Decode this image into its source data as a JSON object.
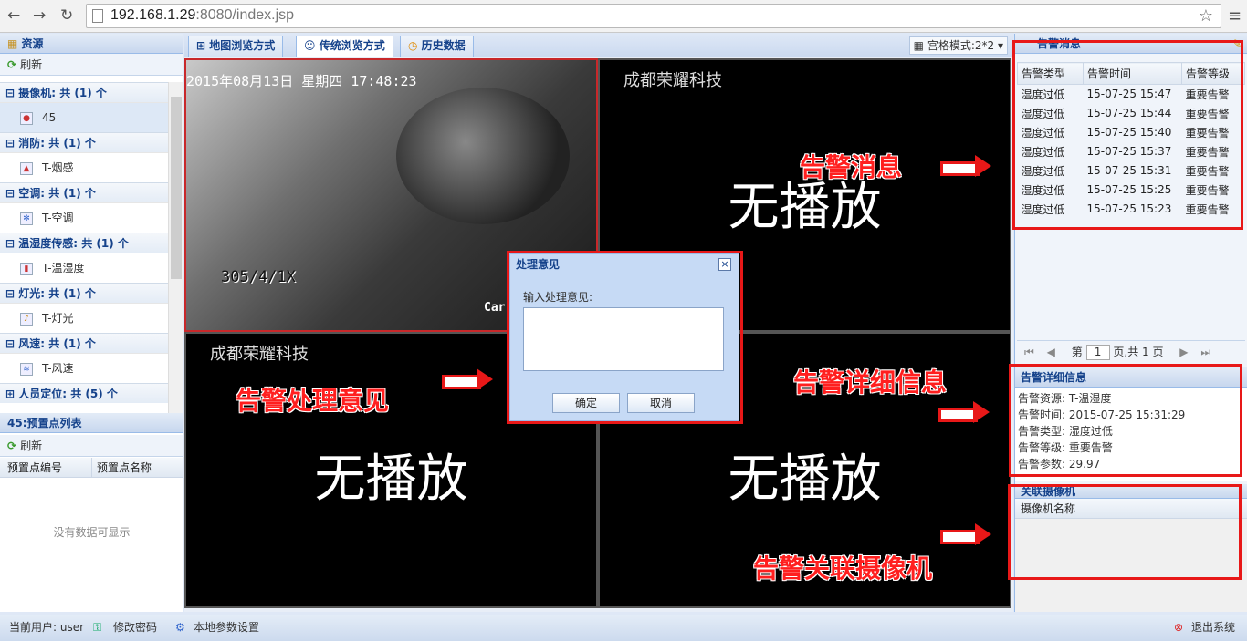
{
  "browser": {
    "url_host": "192.168.1.29",
    "url_rest": ":8080/index.jsp"
  },
  "left": {
    "resources_title": "资源",
    "refresh": "刷新",
    "groups": [
      {
        "name": "摄像机: 共 (1) 个",
        "item": "45",
        "icon": "camera-icon"
      },
      {
        "name": "消防: 共 (1) 个",
        "item": "T-烟感",
        "icon": "fire-icon"
      },
      {
        "name": "空调: 共 (1) 个",
        "item": "T-空调",
        "icon": "snowflake-icon"
      },
      {
        "name": "温湿度传感: 共 (1) 个",
        "item": "T-温湿度",
        "icon": "thermometer-icon"
      },
      {
        "name": "灯光: 共 (1) 个",
        "item": "T-灯光",
        "icon": "bell-icon"
      },
      {
        "name": "风速: 共 (1) 个",
        "item": "T-风速",
        "icon": "wind-icon"
      },
      {
        "name": "人员定位: 共 (5) 个",
        "item": "",
        "icon": ""
      }
    ],
    "preset_title": "45:预置点列表",
    "preset_refresh": "刷新",
    "preset_col1": "预置点编号",
    "preset_col2": "预置点名称",
    "empty": "没有数据可显示"
  },
  "tabs": {
    "map": "地图浏览方式",
    "traditional": "传统浏览方式",
    "history": "历史数据",
    "grid_mode": "宫格模式:2*2"
  },
  "video": {
    "osd_datetime": "2015年08月13日  星期四  17:48:23",
    "osd_ptz": "305/4/1X",
    "osd_cam": "Car",
    "company": "成都荣耀科技",
    "no_play": "无播放"
  },
  "dialog": {
    "title": "处理意见",
    "label": "输入处理意见:",
    "confirm": "确定",
    "cancel": "取消",
    "close": "×"
  },
  "alarms": {
    "title": "告警消息",
    "col_type": "告警类型",
    "col_time": "告警时间",
    "col_level": "告警等级",
    "rows": [
      {
        "type": "湿度过低",
        "time": "15-07-25 15:47",
        "level": "重要告警"
      },
      {
        "type": "湿度过低",
        "time": "15-07-25 15:44",
        "level": "重要告警"
      },
      {
        "type": "湿度过低",
        "time": "15-07-25 15:40",
        "level": "重要告警"
      },
      {
        "type": "湿度过低",
        "time": "15-07-25 15:37",
        "level": "重要告警"
      },
      {
        "type": "湿度过低",
        "time": "15-07-25 15:31",
        "level": "重要告警"
      },
      {
        "type": "湿度过低",
        "time": "15-07-25 15:25",
        "level": "重要告警"
      },
      {
        "type": "湿度过低",
        "time": "15-07-25 15:23",
        "level": "重要告警"
      }
    ],
    "pager_page": "第",
    "pager_value": "1",
    "pager_total": "页,共 1 页"
  },
  "detail": {
    "title": "告警详细信息",
    "source": "告警资源: T-温湿度",
    "time": "告警时间: 2015-07-25 15:31:29",
    "type": "告警类型: 湿度过低",
    "level": "告警等级: 重要告警",
    "param": "告警参数: 29.97"
  },
  "camera_panel": {
    "title": "关联摄像机",
    "col": "摄像机名称"
  },
  "status": {
    "user": "当前用户: user",
    "change_pwd": "修改密码",
    "local_settings": "本地参数设置",
    "logout": "退出系统"
  },
  "annotations": {
    "alarm_msg": "告警消息",
    "handle_opinion": "告警处理意见",
    "alarm_detail": "告警详细信息",
    "alarm_camera": "告警关联摄像机"
  },
  "colors": {
    "accent": "#15428b",
    "annotation_red": "#e81818"
  }
}
